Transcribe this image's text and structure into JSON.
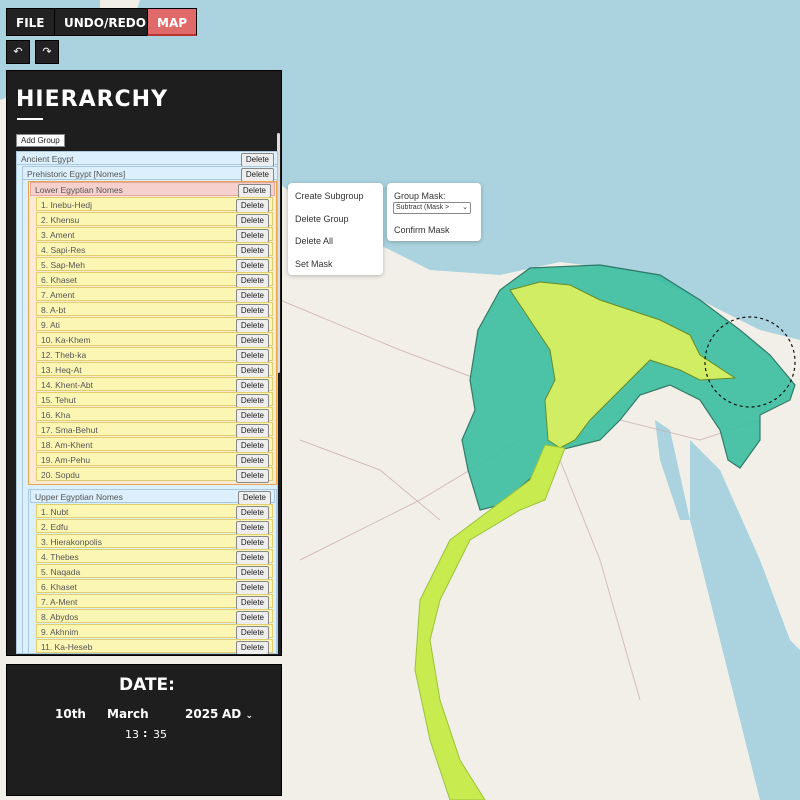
{
  "toolbar": {
    "file_label": "FILE",
    "undo_redo_label": "UNDO/REDO",
    "map_label": "MAP",
    "undo_glyph": "↶",
    "redo_glyph": "↷"
  },
  "hierarchy": {
    "title": "HIERARCHY",
    "add_group_label": "Add Group",
    "delete_label": "Delete",
    "root": "Ancient Egypt",
    "subgroup": "Prehistoric Egypt [Nomes]",
    "lower": {
      "name": "Lower Egyptian Nomes",
      "items": [
        "1. Inebu-Hedj",
        "2. Khensu",
        "3. Ament",
        "4. Sapi-Res",
        "5. Sap-Meh",
        "6. Khaset",
        "7. Ament",
        "8. A-bt",
        "9. Ati",
        "10. Ka-Khem",
        "12. Theb-ka",
        "13. Heq-At",
        "14. Khent-Abt",
        "15. Tehut",
        "16. Kha",
        "17. Sma-Behut",
        "18. Am-Khent",
        "19. Am-Pehu",
        "20. Sopdu"
      ]
    },
    "upper": {
      "name": "Upper Egyptian Nomes",
      "items": [
        "1. Nubt",
        "2. Edfu",
        "3. Hierakonpolis",
        "4. Thebes",
        "5. Naqada",
        "6. Khaset",
        "7. A-Ment",
        "8. Abydos",
        "9. Akhnim",
        "11. Ka-Heseb"
      ]
    }
  },
  "context_menu": {
    "items": [
      "Create Subgroup",
      "Delete Group",
      "Delete All",
      "Set Mask"
    ]
  },
  "mask_menu": {
    "group_mask_label": "Group Mask:",
    "selected_option": "Subtract (Mask > ",
    "confirm_label": "Confirm Mask"
  },
  "date": {
    "title": "DATE:",
    "day": "10th",
    "month": "March",
    "year": "2025",
    "era": "AD",
    "hour": "13",
    "separator": ":",
    "minute": "35"
  },
  "map": {
    "colors": {
      "sea": "#aad3df",
      "land": "#f2efe9",
      "teal_region": "#3bbfa0",
      "yellow_region": "#d8f060",
      "river_strip": "#c8ec50"
    }
  }
}
